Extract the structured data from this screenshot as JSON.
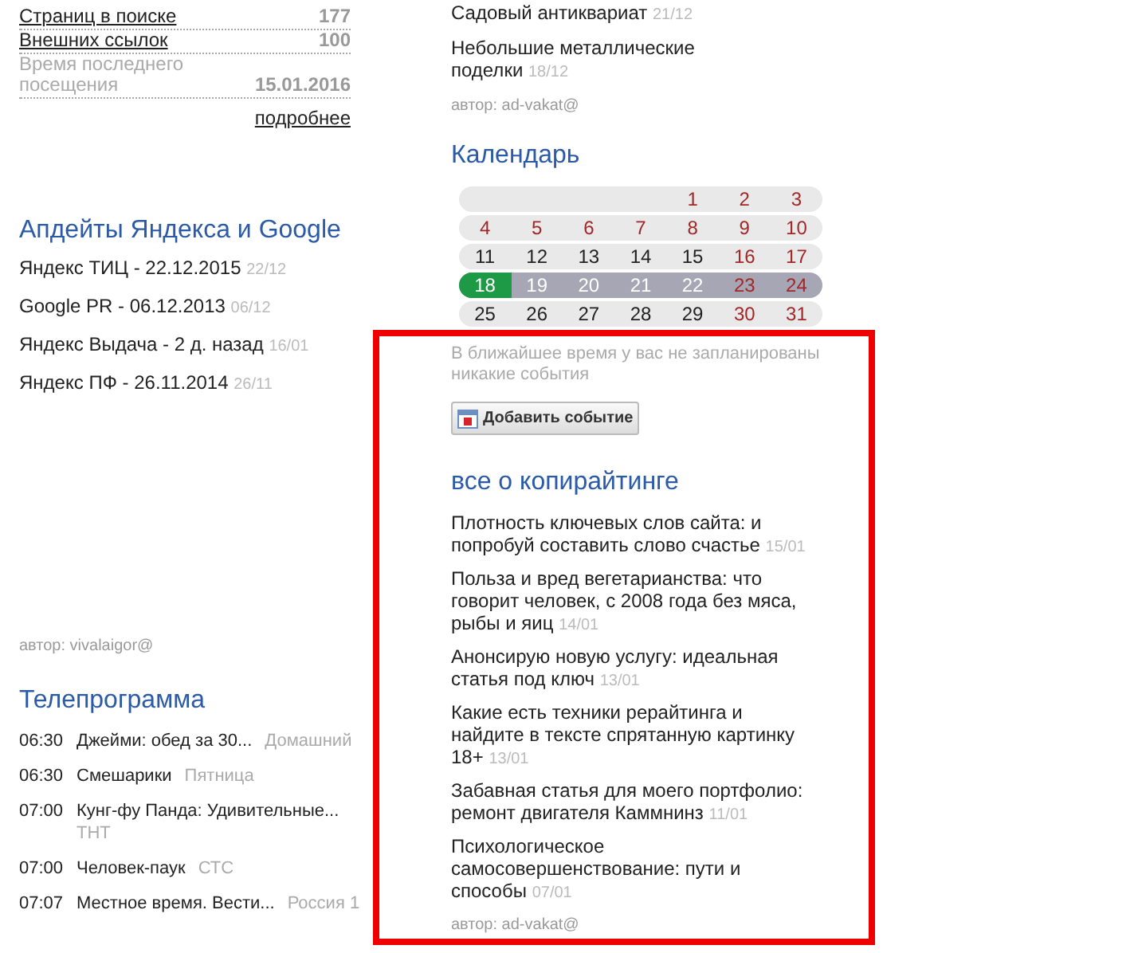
{
  "site_stats": [
    {
      "label": "Страниц в поиске",
      "value": "177",
      "link": true
    },
    {
      "label": "Внешних ссылок",
      "value": "100",
      "link": true
    },
    {
      "label": "Время последнего посещения",
      "value": "15.01.2016",
      "link": false
    }
  ],
  "more_link": "подробнее",
  "updates": {
    "title": "Апдейты Яндекса и Google",
    "items": [
      {
        "text": "Яндекс ТИЦ - 22.12.2015",
        "date": "22/12"
      },
      {
        "text": "Google PR - 06.12.2013",
        "date": "06/12"
      },
      {
        "text": "Яндекс Выдача - 2 д. назад",
        "date": "16/01"
      },
      {
        "text": "Яндекс ПФ - 26.11.2014",
        "date": "26/11"
      }
    ],
    "author": "автор: vivalaigor@"
  },
  "tv": {
    "title": "Телепрограмма",
    "items": [
      {
        "time": "06:30",
        "show": "Джейми: обед за 30...",
        "channel": "Домашний",
        "wrap": false
      },
      {
        "time": "06:30",
        "show": "Смешарики",
        "channel": "Пятница",
        "wrap": false
      },
      {
        "time": "07:00",
        "show": "Кунг-фу Панда: Удивительные...",
        "channel": "ТНТ",
        "wrap": true
      },
      {
        "time": "07:00",
        "show": "Человек-паук",
        "channel": "СТС",
        "wrap": false
      },
      {
        "time": "07:07",
        "show": "Местное время. Вести...",
        "channel": "Россия 1",
        "wrap": false
      }
    ]
  },
  "hobby": {
    "items": [
      {
        "text": "Садовый антиквариат",
        "date": "21/12"
      },
      {
        "text": "Небольшие металлические поделки",
        "date": "18/12"
      }
    ],
    "author": "автор: ad-vakat@"
  },
  "calendar": {
    "title": "Календарь",
    "weeks": [
      {
        "current": false,
        "days": [
          {
            "day": "1",
            "holiday": true,
            "selected": false
          },
          {
            "day": "2",
            "holiday": true,
            "selected": false
          },
          {
            "day": "3",
            "holiday": true,
            "selected": false
          }
        ]
      },
      {
        "current": false,
        "days": [
          {
            "day": "4",
            "holiday": true,
            "selected": false
          },
          {
            "day": "5",
            "holiday": true,
            "selected": false
          },
          {
            "day": "6",
            "holiday": true,
            "selected": false
          },
          {
            "day": "7",
            "holiday": true,
            "selected": false
          },
          {
            "day": "8",
            "holiday": true,
            "selected": false
          },
          {
            "day": "9",
            "holiday": true,
            "selected": false
          },
          {
            "day": "10",
            "holiday": true,
            "selected": false
          }
        ]
      },
      {
        "current": false,
        "days": [
          {
            "day": "11",
            "holiday": false,
            "selected": false
          },
          {
            "day": "12",
            "holiday": false,
            "selected": false
          },
          {
            "day": "13",
            "holiday": false,
            "selected": false
          },
          {
            "day": "14",
            "holiday": false,
            "selected": false
          },
          {
            "day": "15",
            "holiday": false,
            "selected": false
          },
          {
            "day": "16",
            "holiday": true,
            "selected": false
          },
          {
            "day": "17",
            "holiday": true,
            "selected": false
          }
        ]
      },
      {
        "current": true,
        "days": [
          {
            "day": "18",
            "holiday": false,
            "selected": true
          },
          {
            "day": "19",
            "holiday": false,
            "selected": false
          },
          {
            "day": "20",
            "holiday": false,
            "selected": false
          },
          {
            "day": "21",
            "holiday": false,
            "selected": false
          },
          {
            "day": "22",
            "holiday": false,
            "selected": false
          },
          {
            "day": "23",
            "holiday": true,
            "selected": false
          },
          {
            "day": "24",
            "holiday": true,
            "selected": false
          }
        ]
      },
      {
        "current": false,
        "days": [
          {
            "day": "25",
            "holiday": false,
            "selected": false
          },
          {
            "day": "26",
            "holiday": false,
            "selected": false
          },
          {
            "day": "27",
            "holiday": false,
            "selected": false
          },
          {
            "day": "28",
            "holiday": false,
            "selected": false
          },
          {
            "day": "29",
            "holiday": false,
            "selected": false
          },
          {
            "day": "30",
            "holiday": true,
            "selected": false
          },
          {
            "day": "31",
            "holiday": true,
            "selected": false
          }
        ]
      }
    ],
    "note": "В ближайшее время у вас не запланированы никакие события",
    "button": "Добавить событие"
  },
  "copywriting": {
    "title": "все о копирайтинге",
    "items": [
      {
        "text": "Плотность ключевых слов сайта: и попробуй составить слово счастье",
        "date": "15/01"
      },
      {
        "text": "Польза и вред вегетарианства: что говорит человек, с 2008 года без мяса, рыбы и яиц",
        "date": "14/01"
      },
      {
        "text": "Анонсирую новую услугу: идеальная статья под ключ",
        "date": "13/01"
      },
      {
        "text": "Какие есть техники рерайтинга и найдите в тексте спрятанную картинку 18+",
        "date": "13/01"
      },
      {
        "text": "Забавная статья для моего портфолио: ремонт двигателя Каммнинз",
        "date": "11/01"
      },
      {
        "text": "Психологическое самосовершенствование: пути и способы",
        "date": "07/01"
      }
    ],
    "author": "автор: ad-vakat@"
  }
}
